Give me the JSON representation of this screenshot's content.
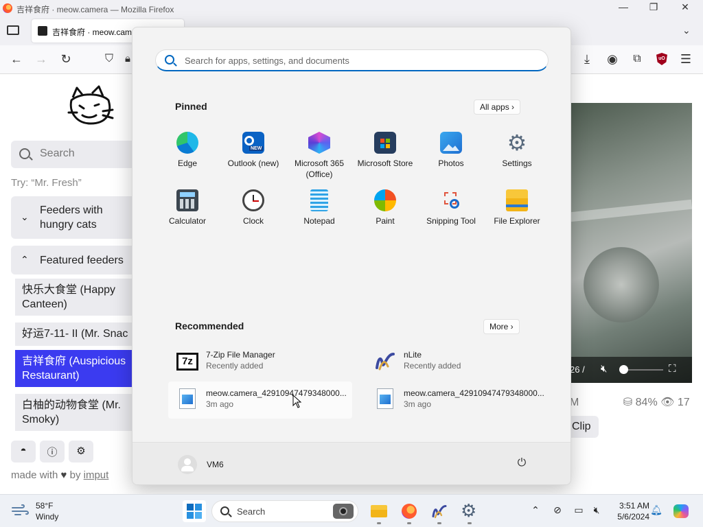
{
  "window": {
    "title": "吉祥食府 · meow.camera — Mozilla Firefox",
    "tab_title": "吉祥食府 · meow.cam"
  },
  "page": {
    "search_placeholder": "Search",
    "try_text": "Try: “Mr. Fresh”",
    "accordion_1": "Feeders with hungry cats",
    "accordion_2": "Featured feeders",
    "feeders": [
      "快乐大食堂 (Happy Canteen)",
      "好运7-11- II  (Mr. Snac",
      "吉祥食府 (Auspicious Restaurant)",
      "白柚的动物食堂 (Mr. Smoky)"
    ],
    "made_with": "made with",
    "made_by": "by",
    "made_link": "imput",
    "video_time": "26 /",
    "stats_prefix": "M",
    "stats_food": "84%",
    "stats_viewers": "17",
    "clip_label": "Clip"
  },
  "start_menu": {
    "search_placeholder": "Search for apps, settings, and documents",
    "pinned_title": "Pinned",
    "all_apps_label": "All apps  ›",
    "pinned_apps": [
      {
        "name": "Edge",
        "icon": "edge-icon"
      },
      {
        "name": "Outlook (new)",
        "icon": "outlook-icon"
      },
      {
        "name": "Microsoft 365 (Office)",
        "icon": "m365-icon"
      },
      {
        "name": "Microsoft Store",
        "icon": "store-icon"
      },
      {
        "name": "Photos",
        "icon": "photos-icon"
      },
      {
        "name": "Settings",
        "icon": "gear-icon"
      },
      {
        "name": "Calculator",
        "icon": "calculator-icon"
      },
      {
        "name": "Clock",
        "icon": "clock-icon"
      },
      {
        "name": "Notepad",
        "icon": "notepad-icon"
      },
      {
        "name": "Paint",
        "icon": "paint-icon"
      },
      {
        "name": "Snipping Tool",
        "icon": "snipping-icon"
      },
      {
        "name": "File Explorer",
        "icon": "folder-icon"
      }
    ],
    "recommended_title": "Recommended",
    "more_label": "More  ›",
    "recommended": [
      {
        "name": "7-Zip File Manager",
        "sub": "Recently added",
        "icon": "7zip-icon"
      },
      {
        "name": "nLite",
        "sub": "Recently added",
        "icon": "nlite-icon"
      },
      {
        "name": "meow.camera_42910947479348000...",
        "sub": "3m ago",
        "icon": "image-file-icon"
      },
      {
        "name": "meow.camera_42910947479348000...",
        "sub": "3m ago",
        "icon": "image-file-icon"
      }
    ],
    "user_name": "VM6"
  },
  "taskbar": {
    "weather_temp": "58°F",
    "weather_desc": "Windy",
    "search_placeholder": "Search",
    "time": "3:51 AM",
    "date": "5/6/2024"
  },
  "colors": {
    "accent": "#0067c0",
    "selected_feeder": "#3b3bf0"
  }
}
